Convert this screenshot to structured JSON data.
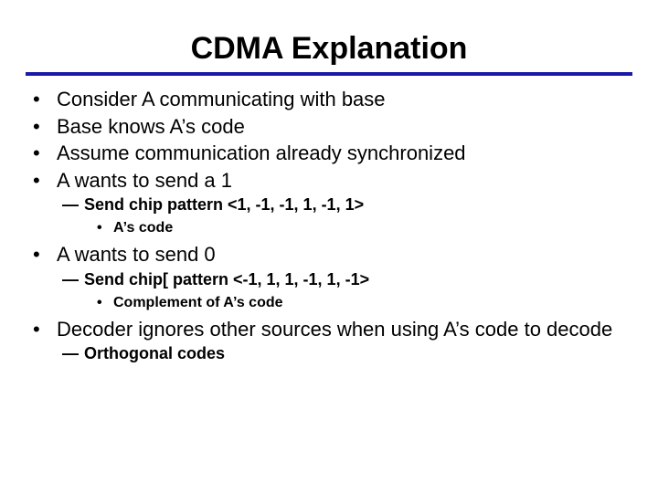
{
  "title": "CDMA Explanation",
  "items": [
    {
      "level": 1,
      "text": "Consider A communicating with base"
    },
    {
      "level": 1,
      "text": "Base knows A’s code"
    },
    {
      "level": 1,
      "text": "Assume communication already synchronized"
    },
    {
      "level": 1,
      "text": "A wants to send a 1"
    },
    {
      "level": 2,
      "text": "Send chip pattern <1, -1, -1, 1, -1, 1>"
    },
    {
      "level": 3,
      "text": "A’s code"
    },
    {
      "level": 1,
      "text": "A wants to send 0"
    },
    {
      "level": 2,
      "text": "Send chip[ pattern <-1, 1, 1, -1, 1, -1>"
    },
    {
      "level": 3,
      "text": "Complement of A’s code"
    },
    {
      "level": 1,
      "text": "Decoder ignores other sources when using A’s code to decode"
    },
    {
      "level": 2,
      "text": "Orthogonal codes"
    }
  ]
}
